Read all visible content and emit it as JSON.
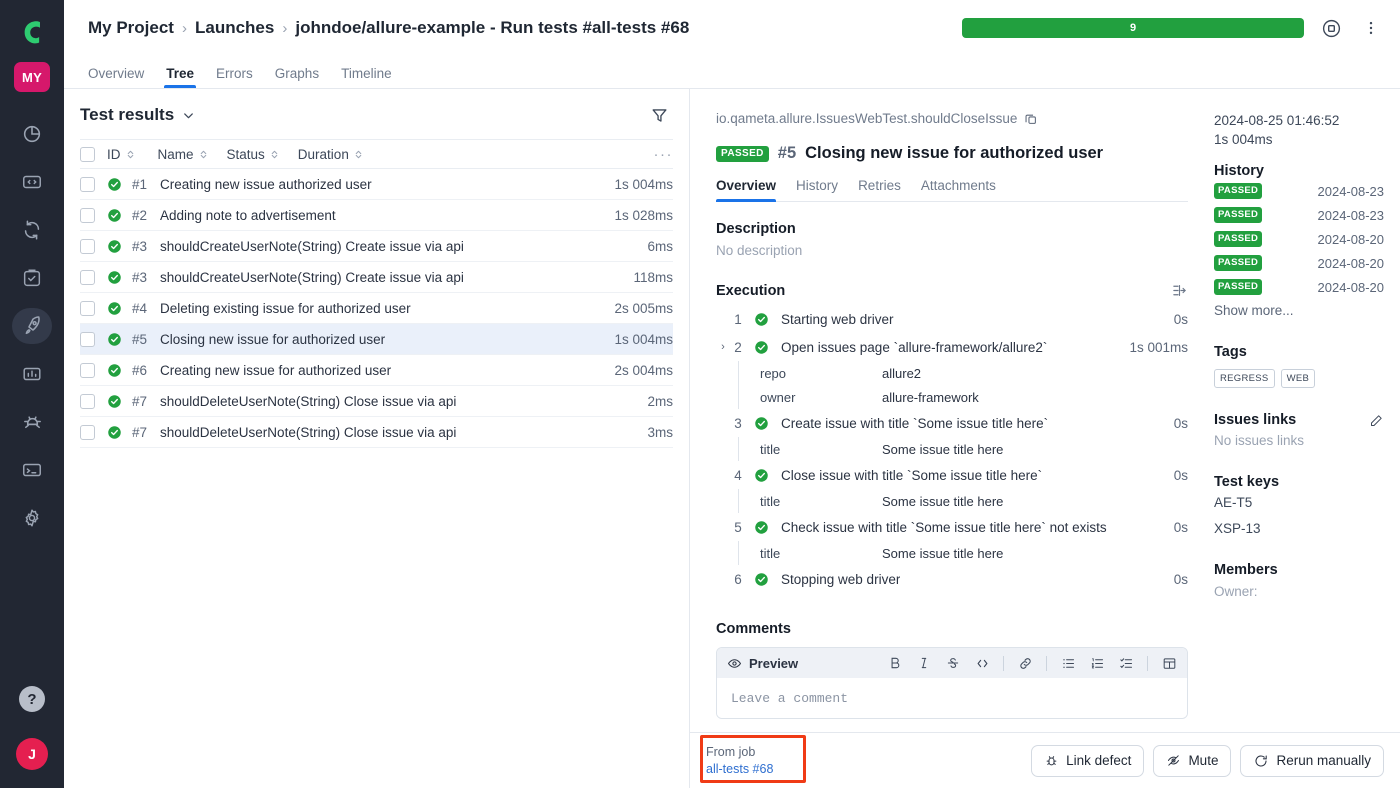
{
  "rail": {
    "logo_icon": "allure-logo-icon",
    "workspace_badge": "MY",
    "items": [
      {
        "icon": "dashboard-pie-icon",
        "name": "dashboard"
      },
      {
        "icon": "code-brackets-icon",
        "name": "code"
      },
      {
        "icon": "sync-arrows-icon",
        "name": "sync"
      },
      {
        "icon": "clipboard-check-icon",
        "name": "test-plan"
      },
      {
        "icon": "rocket-icon",
        "name": "launches",
        "active": true
      },
      {
        "icon": "bar-chart-icon",
        "name": "reports"
      },
      {
        "icon": "bug-icon",
        "name": "defects"
      },
      {
        "icon": "terminal-icon",
        "name": "console"
      },
      {
        "icon": "gear-icon",
        "name": "settings"
      }
    ],
    "help_label": "?",
    "avatar_label": "J"
  },
  "header": {
    "breadcrumbs": [
      {
        "label": "My Project"
      },
      {
        "label": "Launches"
      },
      {
        "label": "johndoe/allure-example - Run tests #all-tests #68"
      }
    ],
    "separator": "›",
    "progress": {
      "label": "9",
      "percent": 100,
      "color": "#22a03f"
    },
    "stop_icon": "stop-circle-icon",
    "more_icon": "more-vertical-icon"
  },
  "tabs": [
    {
      "label": "Overview",
      "active": false
    },
    {
      "label": "Tree",
      "active": true
    },
    {
      "label": "Errors",
      "active": false
    },
    {
      "label": "Graphs",
      "active": false
    },
    {
      "label": "Timeline",
      "active": false
    }
  ],
  "left_panel": {
    "title": "Test results",
    "caret_icon": "chevron-down-icon",
    "filter_icon": "filter-icon",
    "more_icon": "ellipsis-icon",
    "columns": [
      "ID",
      "Name",
      "Status",
      "Duration"
    ],
    "rows": [
      {
        "id": "#1",
        "name": "Creating new issue authorized user",
        "status": "passed",
        "duration": "1s 004ms",
        "selected": false
      },
      {
        "id": "#2",
        "name": "Adding note to advertisement",
        "status": "passed",
        "duration": "1s 028ms",
        "selected": false
      },
      {
        "id": "#3",
        "name": "shouldCreateUserNote(String) Create issue via api",
        "status": "passed",
        "duration": "6ms",
        "selected": false
      },
      {
        "id": "#3",
        "name": "shouldCreateUserNote(String) Create issue via api",
        "status": "passed",
        "duration": "118ms",
        "selected": false
      },
      {
        "id": "#4",
        "name": "Deleting existing issue for authorized user",
        "status": "passed",
        "duration": "2s 005ms",
        "selected": false
      },
      {
        "id": "#5",
        "name": "Closing new issue for authorized user",
        "status": "passed",
        "duration": "1s 004ms",
        "selected": true
      },
      {
        "id": "#6",
        "name": "Creating new issue for authorized user",
        "status": "passed",
        "duration": "2s 004ms",
        "selected": false
      },
      {
        "id": "#7",
        "name": "shouldDeleteUserNote(String) Close issue via api",
        "status": "passed",
        "duration": "2ms",
        "selected": false
      },
      {
        "id": "#7",
        "name": "shouldDeleteUserNote(String) Close issue via api",
        "status": "passed",
        "duration": "3ms",
        "selected": false
      }
    ]
  },
  "detail": {
    "fqn": "io.qameta.allure.IssuesWebTest.shouldCloseIssue",
    "copy_icon": "copy-icon",
    "status_badge": "PASSED",
    "test_number": "#5",
    "test_name": "Closing new issue for authorized user",
    "subtabs": [
      {
        "label": "Overview",
        "active": true
      },
      {
        "label": "History",
        "active": false
      },
      {
        "label": "Retries",
        "active": false
      },
      {
        "label": "Attachments",
        "active": false
      }
    ],
    "description": {
      "title": "Description",
      "value": "No description"
    },
    "execution": {
      "title": "Execution",
      "toggle_icon": "expand-collapse-icon",
      "steps": [
        {
          "num": "1",
          "text": "Starting web driver",
          "duration": "0s",
          "status": "passed",
          "expandable": false,
          "params": []
        },
        {
          "num": "2",
          "text": "Open issues page `allure-framework/allure2`",
          "duration": "1s 001ms",
          "status": "passed",
          "expandable": true,
          "params": [
            {
              "key": "repo",
              "value": "allure2"
            },
            {
              "key": "owner",
              "value": "allure-framework"
            }
          ]
        },
        {
          "num": "3",
          "text": "Create issue with title `Some issue title here`",
          "duration": "0s",
          "status": "passed",
          "expandable": false,
          "params": [
            {
              "key": "title",
              "value": "Some issue title here"
            }
          ]
        },
        {
          "num": "4",
          "text": "Close issue with title `Some issue title here`",
          "duration": "0s",
          "status": "passed",
          "expandable": false,
          "params": [
            {
              "key": "title",
              "value": "Some issue title here"
            }
          ]
        },
        {
          "num": "5",
          "text": "Check issue with title `Some issue title here` not exists",
          "duration": "0s",
          "status": "passed",
          "expandable": false,
          "params": [
            {
              "key": "title",
              "value": "Some issue title here"
            }
          ]
        },
        {
          "num": "6",
          "text": "Stopping web driver",
          "duration": "0s",
          "status": "passed",
          "expandable": false,
          "params": []
        }
      ]
    },
    "comments": {
      "title": "Comments",
      "preview_label": "Preview",
      "preview_icon": "eye-icon",
      "placeholder": "Leave a comment",
      "tools": [
        {
          "icon": "bold-icon",
          "glyph": "B"
        },
        {
          "icon": "italic-icon",
          "glyph": "I"
        },
        {
          "icon": "strikethrough-icon",
          "glyph": "S"
        },
        {
          "icon": "code-icon",
          "glyph": "</>"
        },
        {
          "icon": "link-icon",
          "glyph": "🔗"
        },
        {
          "icon": "bulleted-list-icon",
          "glyph": "•≡"
        },
        {
          "icon": "numbered-list-icon",
          "glyph": "1≡"
        },
        {
          "icon": "checklist-icon",
          "glyph": "✓≡"
        },
        {
          "icon": "table-icon",
          "glyph": "▦"
        }
      ]
    }
  },
  "side": {
    "timestamp": "2024-08-25 01:46:52",
    "duration": "1s 004ms",
    "history_title": "History",
    "history": [
      {
        "status": "PASSED",
        "date": "2024-08-23"
      },
      {
        "status": "PASSED",
        "date": "2024-08-23"
      },
      {
        "status": "PASSED",
        "date": "2024-08-20"
      },
      {
        "status": "PASSED",
        "date": "2024-08-20"
      },
      {
        "status": "PASSED",
        "date": "2024-08-20"
      }
    ],
    "show_more": "Show more...",
    "tags_title": "Tags",
    "tags": [
      "REGRESS",
      "WEB"
    ],
    "issues_title": "Issues links",
    "issues_edit_icon": "pencil-icon",
    "issues_value": "No issues links",
    "test_keys_title": "Test keys",
    "test_keys": [
      "AE-T5",
      "XSP-13"
    ],
    "members_title": "Members",
    "members_owner_label": "Owner:"
  },
  "bottom": {
    "from_job_label": "From job",
    "from_job_link": "all-tests #68",
    "buttons": [
      {
        "label": "Link defect",
        "icon": "bug-icon"
      },
      {
        "label": "Mute",
        "icon": "eye-off-icon"
      },
      {
        "label": "Rerun manually",
        "icon": "refresh-icon"
      }
    ]
  },
  "annotation": {
    "color": "#f03b16"
  }
}
